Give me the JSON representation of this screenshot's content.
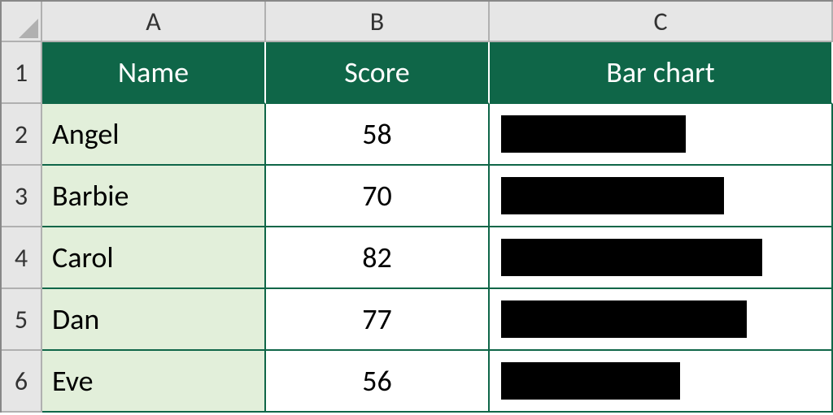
{
  "columns": {
    "A": "A",
    "B": "B",
    "C": "C"
  },
  "row_numbers": [
    "1",
    "2",
    "3",
    "4",
    "5",
    "6"
  ],
  "headers": {
    "name": "Name",
    "score": "Score",
    "bar": "Bar chart"
  },
  "rows": [
    {
      "name": "Angel",
      "score": "58"
    },
    {
      "name": "Barbie",
      "score": "70"
    },
    {
      "name": "Carol",
      "score": "82"
    },
    {
      "name": "Dan",
      "score": "77"
    },
    {
      "name": "Eve",
      "score": "56"
    }
  ],
  "chart_data": {
    "type": "bar",
    "categories": [
      "Angel",
      "Barbie",
      "Carol",
      "Dan",
      "Eve"
    ],
    "values": [
      58,
      70,
      82,
      77,
      56
    ],
    "title": "",
    "xlabel": "Score",
    "ylabel": "Name",
    "ylim": [
      0,
      100
    ]
  }
}
